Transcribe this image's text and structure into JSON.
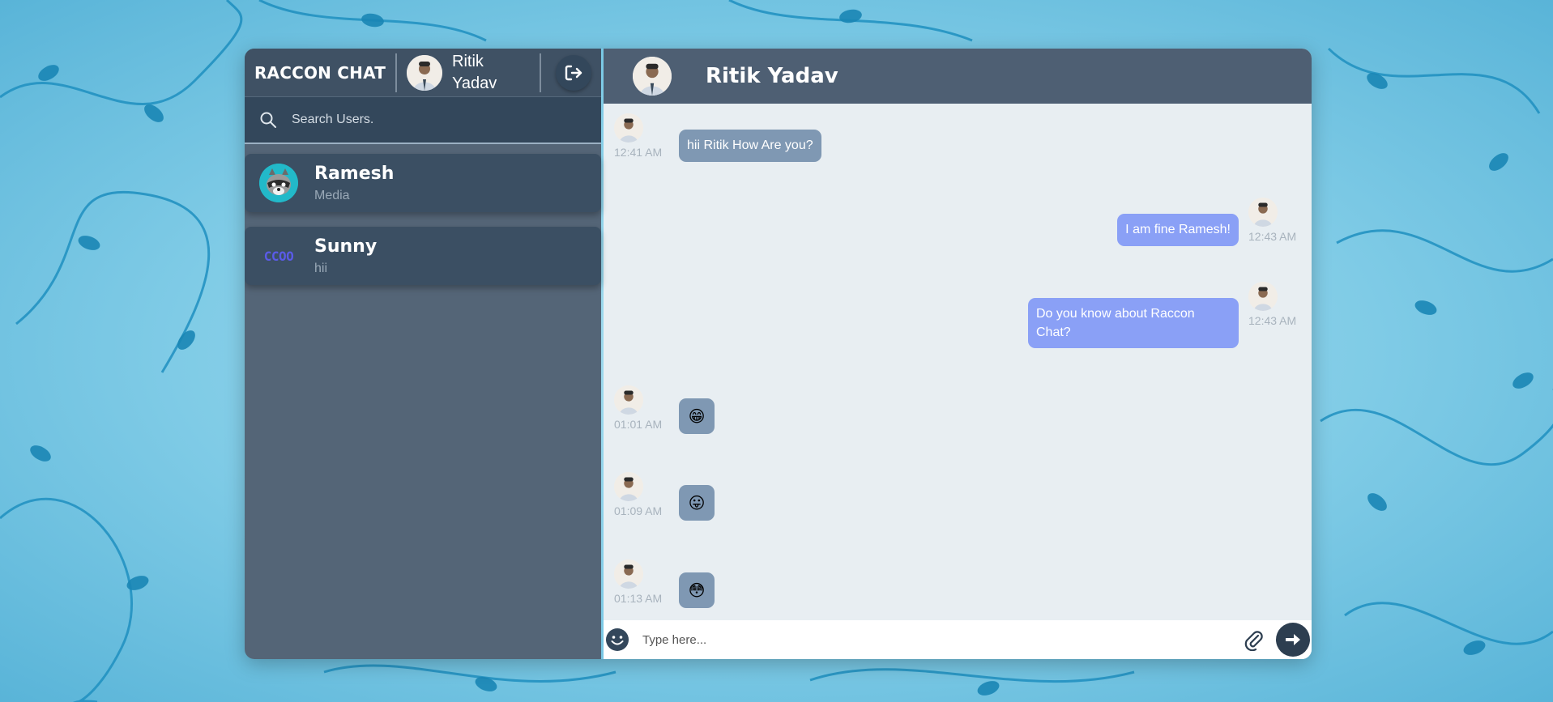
{
  "app": {
    "brand": "RACCON CHAT"
  },
  "current_user": {
    "name": "Ritik Yadav",
    "name_line1": "Ritik",
    "name_line2": "Yadav"
  },
  "search": {
    "placeholder": "Search Users."
  },
  "users": [
    {
      "name": "Ramesh",
      "last_message": "Media",
      "avatar": "raccoon-icon"
    },
    {
      "name": "Sunny",
      "last_message": "hii",
      "avatar_text": "CCOO"
    }
  ],
  "chat": {
    "title": "Ritik Yadav",
    "messages": [
      {
        "direction": "in",
        "text": "hii Ritik How Are you?",
        "time": "12:41 AM"
      },
      {
        "direction": "out",
        "text": "I am fine Ramesh!",
        "time": "12:43 AM"
      },
      {
        "direction": "out",
        "text_line1": "Do you know about Raccon",
        "text_line2": "Chat?",
        "time": "12:43 AM"
      },
      {
        "direction": "in",
        "emoji": "😁",
        "time": "01:01 AM"
      },
      {
        "direction": "in",
        "emoji": "😛",
        "time": "01:09 AM"
      },
      {
        "direction": "in",
        "emoji": "😳",
        "time": "01:13 AM"
      }
    ]
  },
  "composer": {
    "placeholder": "Type here..."
  },
  "colors": {
    "sidebar": "#546577",
    "header": "#3f5164",
    "bubble_in": "#7f98b3",
    "bubble_out": "#8aa0f6",
    "send": "#2d3e50"
  }
}
